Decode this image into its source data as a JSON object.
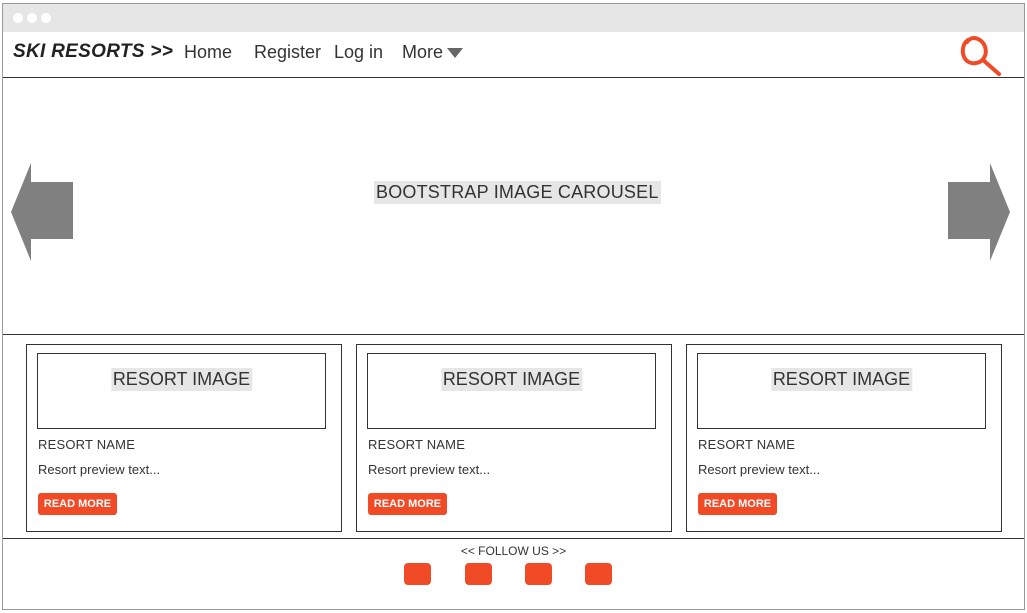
{
  "nav": {
    "brand": "SKI RESORTS >>",
    "links": [
      "Home",
      "Register",
      "Log in",
      "More"
    ],
    "search_icon": "search-icon"
  },
  "carousel": {
    "label": "BOOTSTRAP IMAGE CAROUSEL",
    "prev_icon": "arrow-left-icon",
    "next_icon": "arrow-right-icon"
  },
  "cards": [
    {
      "image_label": "RESORT IMAGE",
      "name": "RESORT NAME",
      "text": "Resort preview text...",
      "button": "READ MORE"
    },
    {
      "image_label": "RESORT IMAGE",
      "name": "RESORT NAME",
      "text": "Resort preview text...",
      "button": "READ MORE"
    },
    {
      "image_label": "RESORT IMAGE",
      "name": "RESORT NAME",
      "text": "Resort preview text...",
      "button": "READ MORE"
    }
  ],
  "footer": {
    "follow_label": "<< FOLLOW US >>",
    "social_count": 4
  },
  "colors": {
    "accent": "#f14a26",
    "arrow": "#808080",
    "placeholder_bg": "#e6e6e6"
  }
}
